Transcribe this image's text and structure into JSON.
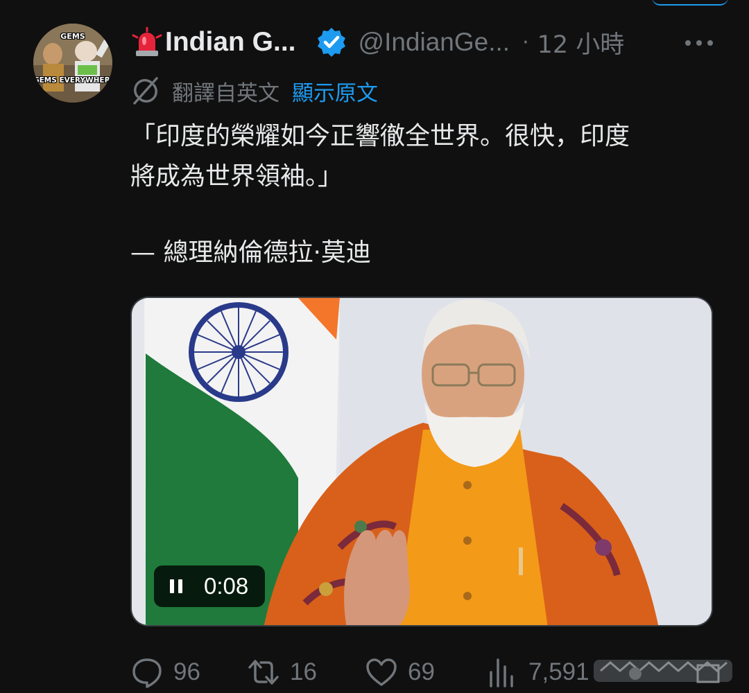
{
  "author": {
    "avatar_caption_top": "GEMS",
    "avatar_caption_bottom": "GEMS EVERYWHERE",
    "display_name": "Indian G...",
    "handle": "@IndianGe...",
    "separator": "·",
    "time": "12 小時"
  },
  "translation": {
    "translated_from": "翻譯自英文",
    "show_original": "顯示原文"
  },
  "tweet": {
    "line1": "「印度的榮耀如今正響徹全世界。很快，印度",
    "line2": "將成為世界領袖。」",
    "attribution": "— 總理納倫德拉·莫迪"
  },
  "video": {
    "time": "0:08"
  },
  "actions": {
    "replies": "96",
    "reposts": "16",
    "likes": "69",
    "views": "7,591"
  },
  "colors": {
    "background": "#101010",
    "accent": "#1d9bf0",
    "muted": "#71767b",
    "text": "#e7e9ea"
  },
  "icons": [
    "siren-icon",
    "verified-badge-icon",
    "more-icon",
    "translate-icon",
    "pause-icon",
    "reply-icon",
    "repost-icon",
    "like-icon",
    "views-icon",
    "share-icon"
  ]
}
